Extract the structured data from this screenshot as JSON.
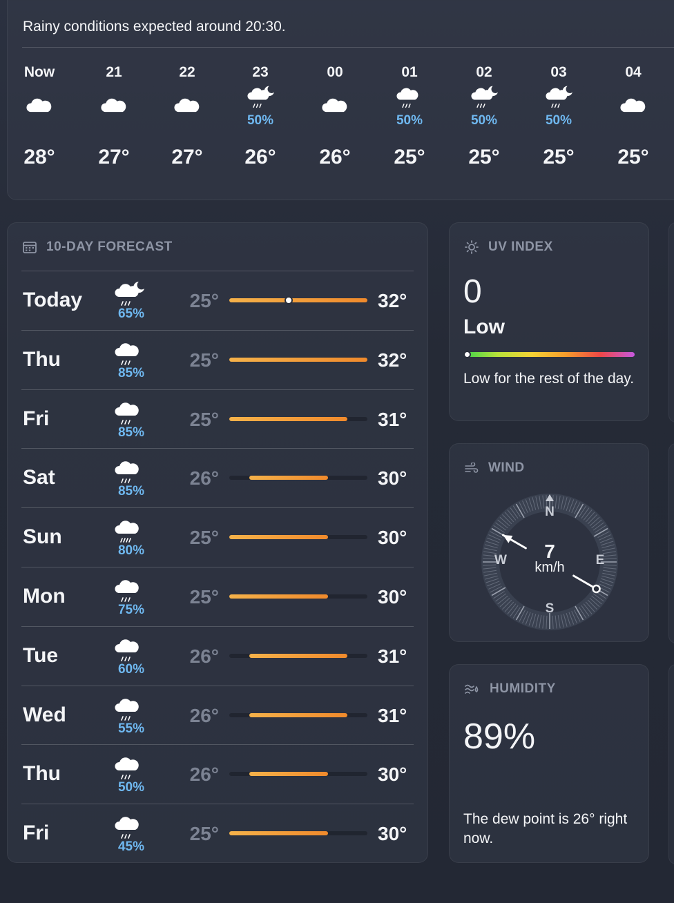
{
  "hourly": {
    "summary": "Rainy conditions expected around 20:30.",
    "hours": [
      {
        "time": "Now",
        "icon": "cloud-icon",
        "pct": "",
        "temp": "28°"
      },
      {
        "time": "21",
        "icon": "cloud-icon",
        "pct": "",
        "temp": "27°"
      },
      {
        "time": "22",
        "icon": "cloud-icon",
        "pct": "",
        "temp": "27°"
      },
      {
        "time": "23",
        "icon": "cloud-moon-rain-icon",
        "pct": "50%",
        "temp": "26°"
      },
      {
        "time": "00",
        "icon": "cloud-icon",
        "pct": "",
        "temp": "26°"
      },
      {
        "time": "01",
        "icon": "cloud-rain-icon",
        "pct": "50%",
        "temp": "25°"
      },
      {
        "time": "02",
        "icon": "cloud-moon-rain-icon",
        "pct": "50%",
        "temp": "25°"
      },
      {
        "time": "03",
        "icon": "cloud-moon-rain-icon",
        "pct": "50%",
        "temp": "25°"
      },
      {
        "time": "04",
        "icon": "cloud-icon",
        "pct": "",
        "temp": "25°"
      }
    ]
  },
  "forecast": {
    "title": "10-DAY FORECAST",
    "range": [
      25,
      32
    ],
    "current_temp": 28,
    "days": [
      {
        "day": "Today",
        "icon": "cloud-moon-rain-icon",
        "pct": "65%",
        "low": "25°",
        "high": "32°"
      },
      {
        "day": "Thu",
        "icon": "cloud-rain-icon",
        "pct": "85%",
        "low": "25°",
        "high": "32°"
      },
      {
        "day": "Fri",
        "icon": "cloud-rain-icon",
        "pct": "85%",
        "low": "25°",
        "high": "31°"
      },
      {
        "day": "Sat",
        "icon": "cloud-rain-icon",
        "pct": "85%",
        "low": "26°",
        "high": "30°"
      },
      {
        "day": "Sun",
        "icon": "cloud-heavy-rain-icon",
        "pct": "80%",
        "low": "25°",
        "high": "30°"
      },
      {
        "day": "Mon",
        "icon": "cloud-rain-icon",
        "pct": "75%",
        "low": "25°",
        "high": "30°"
      },
      {
        "day": "Tue",
        "icon": "cloud-rain-icon",
        "pct": "60%",
        "low": "26°",
        "high": "31°"
      },
      {
        "day": "Wed",
        "icon": "cloud-rain-icon",
        "pct": "55%",
        "low": "26°",
        "high": "31°"
      },
      {
        "day": "Thu",
        "icon": "cloud-rain-icon",
        "pct": "50%",
        "low": "26°",
        "high": "30°"
      },
      {
        "day": "Fri",
        "icon": "cloud-rain-icon",
        "pct": "45%",
        "low": "25°",
        "high": "30°"
      }
    ]
  },
  "uv": {
    "title": "UV INDEX",
    "value": "0",
    "level": "Low",
    "description": "Low for the rest of the day."
  },
  "wind": {
    "title": "WIND",
    "speed": "7",
    "unit": "km/h",
    "directions": {
      "n": "N",
      "e": "E",
      "s": "S",
      "w": "W"
    },
    "direction_deg": 120
  },
  "humidity": {
    "title": "HUMIDITY",
    "value": "89%",
    "description": "The dew point is 26° right now."
  },
  "colors": {
    "precip": "#6fb8f0",
    "bar_start": "#f5b24a",
    "bar_end": "#f08a2c"
  }
}
